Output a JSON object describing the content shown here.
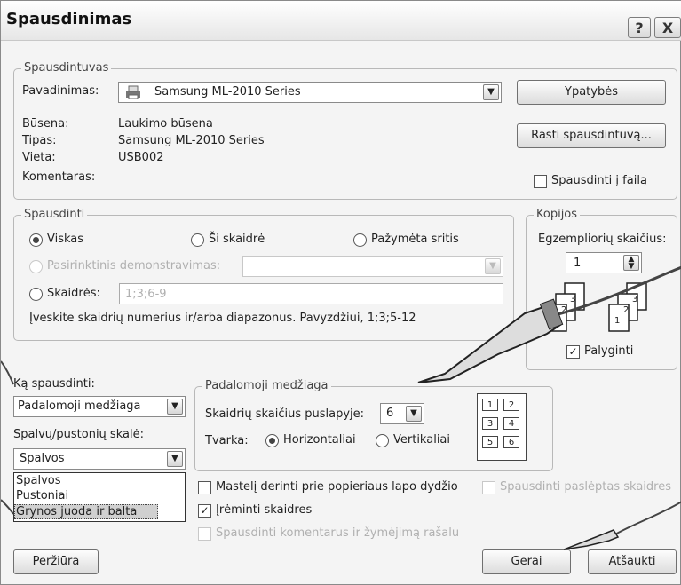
{
  "window": {
    "title": "Spausdinimas",
    "help_label": "?",
    "close_label": "X"
  },
  "printer": {
    "legend": "Spausdintuvas",
    "name_label": "Pavadinimas:",
    "name_value": "Samsung ML-2010 Series",
    "status_label": "Būsena:",
    "status_value": "Laukimo būsena",
    "type_label": "Tipas:",
    "type_value": "Samsung ML-2010 Series",
    "location_label": "Vieta:",
    "location_value": "USB002",
    "comment_label": "Komentaras:",
    "properties_button": "Ypatybės",
    "find_button": "Rasti spausdintuvą...",
    "print_to_file_label": "Spausdinti į failą"
  },
  "range": {
    "legend": "Spausdinti",
    "all_label": "Viskas",
    "current_label": "Ši skaidrė",
    "selection_label": "Pažymėta sritis",
    "custom_show_label": "Pasirinktinis demonstravimas:",
    "slides_label": "Skaidrės:",
    "slides_value": "1;3;6-9",
    "hint": "Įveskite skaidrių numerius ir/arba diapazonus. Pavyzdžiui, 1;3;5-12"
  },
  "copies": {
    "legend": "Kopijos",
    "count_label": "Egzempliorių skaičius:",
    "count_value": "1",
    "collate_label": "Palyginti",
    "collate_pages": [
      "1",
      "2",
      "3"
    ]
  },
  "what": {
    "label": "Ką spausdinti:",
    "value": "Padalomoji medžiaga",
    "color_label": "Spalvų/pustonių skalė:",
    "color_value": "Spalvos",
    "color_options": [
      "Spalvos",
      "Pustoniai",
      "Grynos juoda ir balta"
    ]
  },
  "handouts": {
    "legend": "Padalomoji medžiaga",
    "per_page_label": "Skaidrių skaičius puslapyje:",
    "per_page_value": "6",
    "order_label": "Tvarka:",
    "horizontal_label": "Horizontaliai",
    "vertical_label": "Vertikaliai",
    "preview_pages": [
      "1",
      "2",
      "3",
      "4",
      "5",
      "6"
    ]
  },
  "options": {
    "scale_label": "Mastelį derinti prie popieriaus lapo dydžio",
    "hidden_label": "Spausdinti paslėptas skaidres",
    "frame_label": "Įrėminti skaidres",
    "comments_label": "Spausdinti komentarus ir žymėjimą rašalu"
  },
  "footer": {
    "preview_button": "Peržiūra",
    "ok_button": "Gerai",
    "cancel_button": "Atšaukti"
  }
}
